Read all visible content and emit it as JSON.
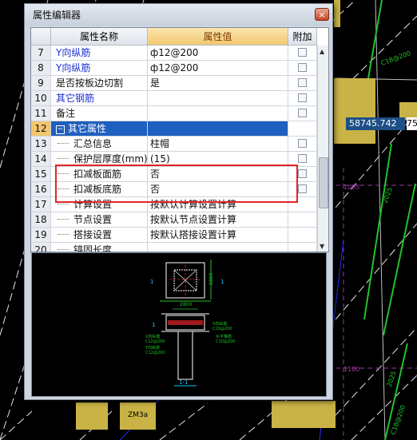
{
  "dialog": {
    "title": "属性编辑器",
    "close_glyph": "×"
  },
  "grid": {
    "columns": {
      "name": "属性名称",
      "value": "属性值",
      "add": "附加"
    },
    "rows": [
      {
        "num": "7",
        "name": "Y向纵筋",
        "value": "ф12@200",
        "checkbox": true
      },
      {
        "num": "8",
        "name": "Y向纵筋",
        "value": "ф12@200",
        "checkbox": true
      },
      {
        "num": "9",
        "name": "是否按板边切割",
        "value": "是",
        "checkbox": true
      },
      {
        "num": "10",
        "name": "其它钢筋",
        "value": "",
        "checkbox": true
      },
      {
        "num": "11",
        "name": "备注",
        "value": "",
        "checkbox": true
      },
      {
        "num": "12",
        "name": "其它属性",
        "value": "",
        "checkbox": false,
        "expander": "−"
      },
      {
        "num": "13",
        "name": "汇总信息",
        "value": "柱帽",
        "checkbox": true
      },
      {
        "num": "14",
        "name": "保护层厚度(mm)",
        "value": "(15)",
        "checkbox": true
      },
      {
        "num": "15",
        "name": "扣减板面筋",
        "value": "否",
        "checkbox": true
      },
      {
        "num": "16",
        "name": "扣减板底筋",
        "value": "否",
        "checkbox": true
      },
      {
        "num": "17",
        "name": "计算设置",
        "value": "按默认计算设置计算",
        "checkbox": false
      },
      {
        "num": "18",
        "name": "节点设置",
        "value": "按默认节点设置计算",
        "checkbox": false
      },
      {
        "num": "19",
        "name": "搭接设置",
        "value": "按默认搭接设置计算",
        "checkbox": false
      },
      {
        "num": "20",
        "name": "锚固长度",
        "value": "",
        "checkbox": false
      }
    ]
  },
  "preview": {
    "dim_top": "2800",
    "dim_side": "2800",
    "label_left_top": "1",
    "label_left_bottom": "1",
    "label_right": "1",
    "label_x_bar": "X向纵筋",
    "label_x_spec": "C12@200",
    "label_y_bar": "Y向纵筋",
    "label_y_spec": "C12@200",
    "label_bottom_x": "X向纵筋",
    "label_bottom_x_spec": "C10@200",
    "label_ring": "水平箍筋",
    "label_ring_spec": "C10@200",
    "section_label": "1-1"
  },
  "cad": {
    "coordinate": "58745.742",
    "coordinate_next": "75",
    "tag_zm": "ZM3a",
    "label_c18": "C18@200",
    "label_2025": "2025",
    "label_1005": "1005",
    "label_1100": "1100",
    "label_c18b": "C18@200"
  },
  "colors": {
    "cad_green": "#22c22a",
    "cad_yellow": "#c9b346",
    "cad_blue": "#2d2bff",
    "highlight_red": "#e2232a"
  }
}
